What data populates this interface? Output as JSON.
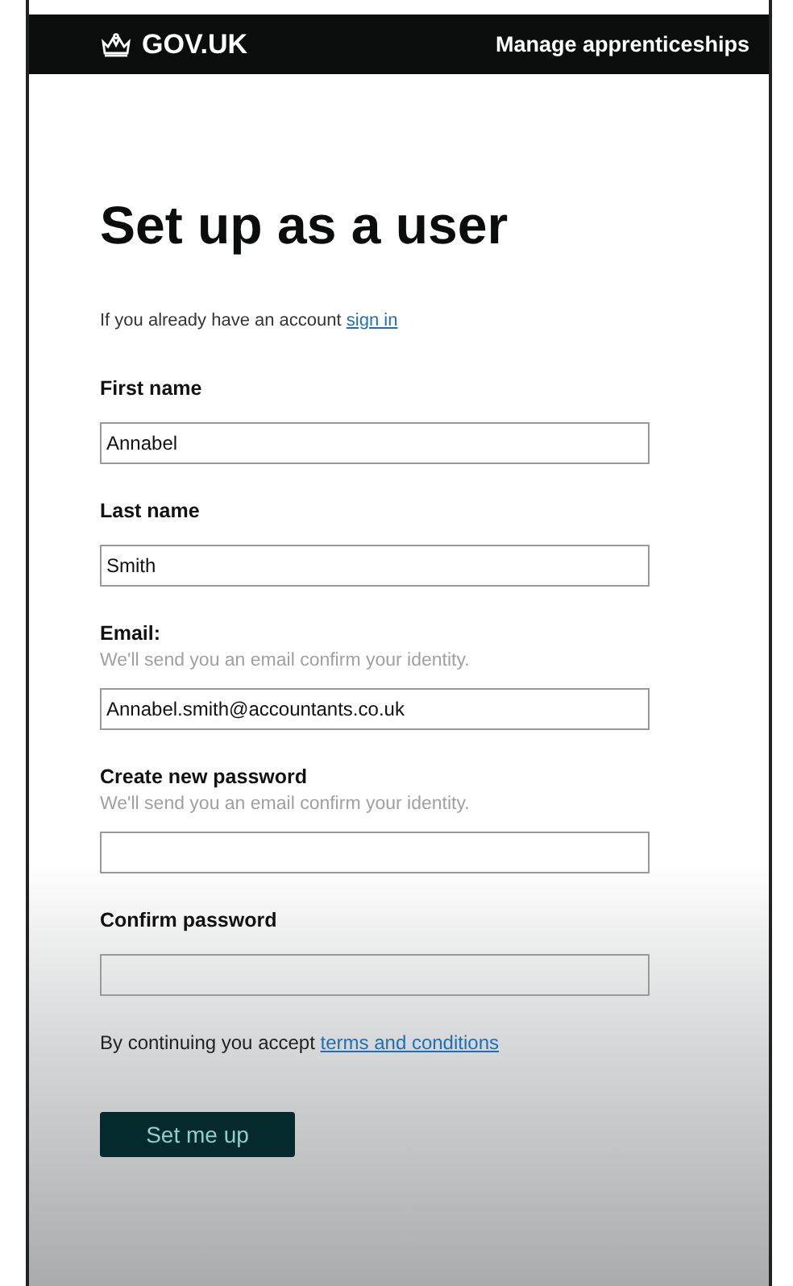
{
  "header": {
    "logo": "GOV.UK",
    "service": "Manage apprenticeships"
  },
  "title": "Set up as a user",
  "intro": {
    "text": "If you already have an account",
    "link": "sign in"
  },
  "fields": [
    {
      "label": "First name",
      "value": "Annabel"
    },
    {
      "label": "Last name",
      "value": "Smith"
    },
    {
      "label": "Email:",
      "hint": "We'll send you an email confirm your identity.",
      "value": "Annabel.smith@accountants.co.uk"
    },
    {
      "label": "Create new password",
      "hint": "We'll send you an email confirm your identity."
    },
    {
      "label": "Confirm password"
    }
  ],
  "terms": {
    "text": "By continuing you accept",
    "link": "terms and conditions"
  },
  "button": "Set me up"
}
